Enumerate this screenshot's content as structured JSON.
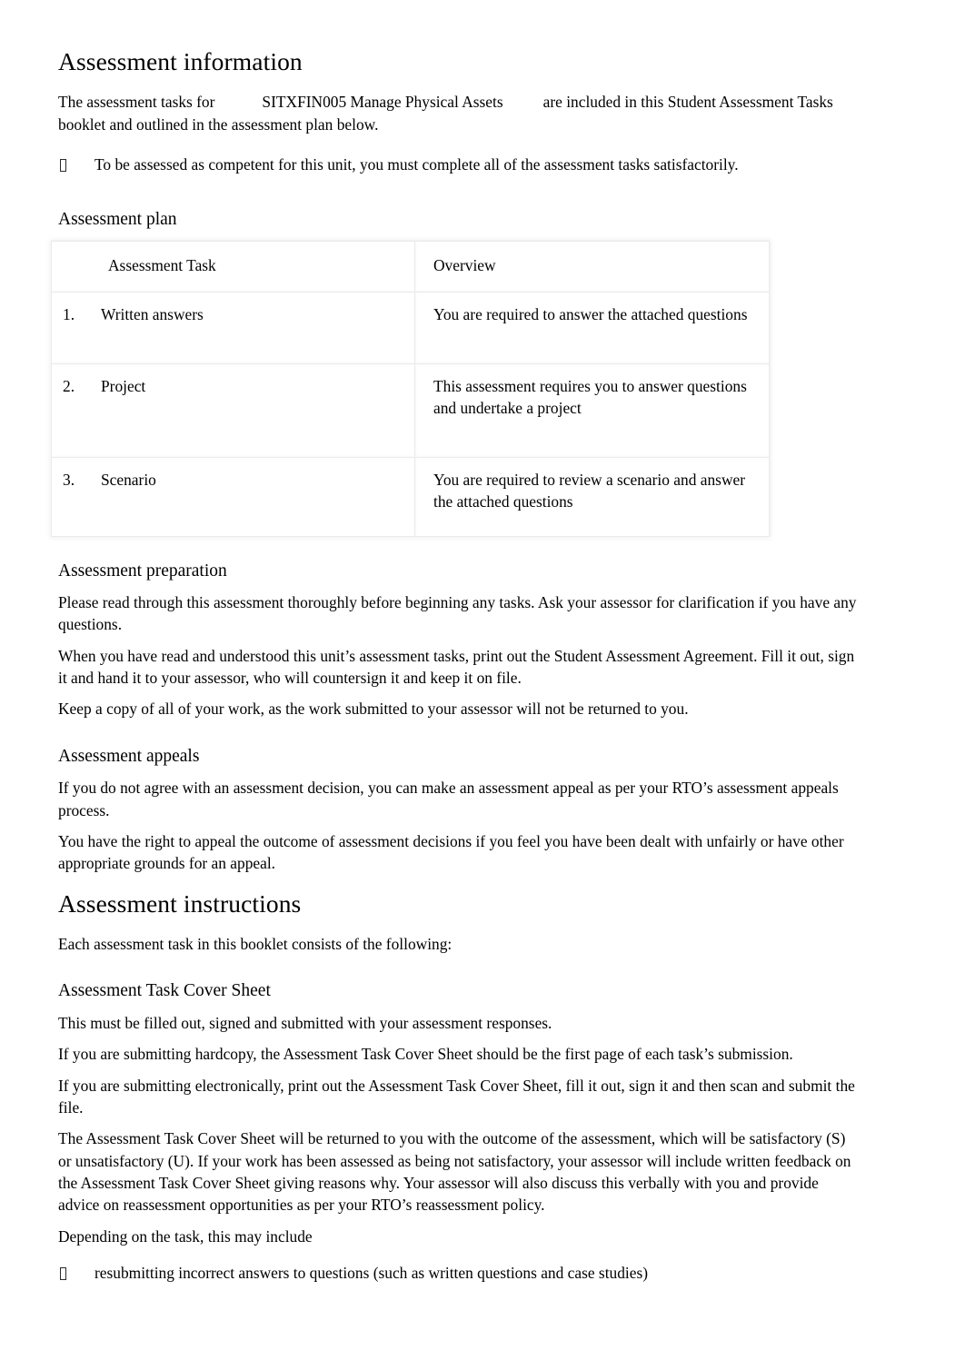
{
  "document": {
    "title": "Assessment information",
    "intro": {
      "prefix": "The assessment tasks for",
      "unit_code": "SITXFIN005 Manage Physical Assets",
      "suffix": "are included in this Student Assessment Tasks booklet and outlined in the assessment plan below."
    },
    "intro_bullet": "To be assessed as competent for this unit, you must complete all of the assessment tasks satisfactorily.",
    "assessment_plan": {
      "heading": "Assessment plan",
      "columns": [
        "Assessment Task",
        "Overview"
      ],
      "rows": [
        {
          "number": "1.",
          "task": "Written answers",
          "overview": "You are required to answer the attached questions"
        },
        {
          "number": "2.",
          "task": "Project",
          "overview": "This assessment requires you to answer questions and undertake a project"
        },
        {
          "number": "3.",
          "task": "Scenario",
          "overview": "You are required to review a scenario and answer the attached questions"
        }
      ]
    },
    "assessment_preparation": {
      "heading": "Assessment preparation",
      "paragraphs": [
        "Please read through this assessment thoroughly before beginning any tasks. Ask your assessor for clarification if you have any questions.",
        "When you have read and understood this unit’s assessment tasks, print out the Student Assessment Agreement. Fill it out, sign it and hand it to your assessor, who will countersign it and keep it on file.",
        "Keep a copy of all of your work, as the work submitted to your assessor will not be returned to you."
      ]
    },
    "assessment_appeals": {
      "heading": "Assessment appeals",
      "paragraphs": [
        "If you do not agree with an assessment decision, you can make an assessment appeal as per your RTO’s assessment appeals process.",
        "You have the right to appeal the outcome of assessment decisions if you feel you have been dealt with unfairly or have other appropriate grounds for an appeal."
      ]
    },
    "assessment_instructions": {
      "heading": "Assessment instructions",
      "lead": "Each assessment task in this booklet consists of the following:",
      "cover_sheet": {
        "heading": "Assessment Task Cover Sheet",
        "paragraphs": [
          "This must be filled out, signed and submitted with your assessment responses.",
          "If you are submitting hardcopy, the Assessment Task Cover Sheet should be the first page of each task’s submission.",
          "If you are submitting electronically, print out the Assessment Task Cover Sheet, fill it out, sign it and then scan and submit the file.",
          "The Assessment Task Cover Sheet will be returned to you with the outcome of the assessment, which will be satisfactory (S) or unsatisfactory (U). If your work has been assessed as being not satisfactory, your assessor will include written feedback on the Assessment Task Cover Sheet giving reasons why. Your assessor will also discuss this verbally with you and provide advice on reassessment opportunities as per your RTO’s reassessment policy.",
          "Depending on the task, this may include"
        ],
        "bullet": "resubmitting incorrect answers to questions (such as written questions and case studies)"
      }
    }
  }
}
